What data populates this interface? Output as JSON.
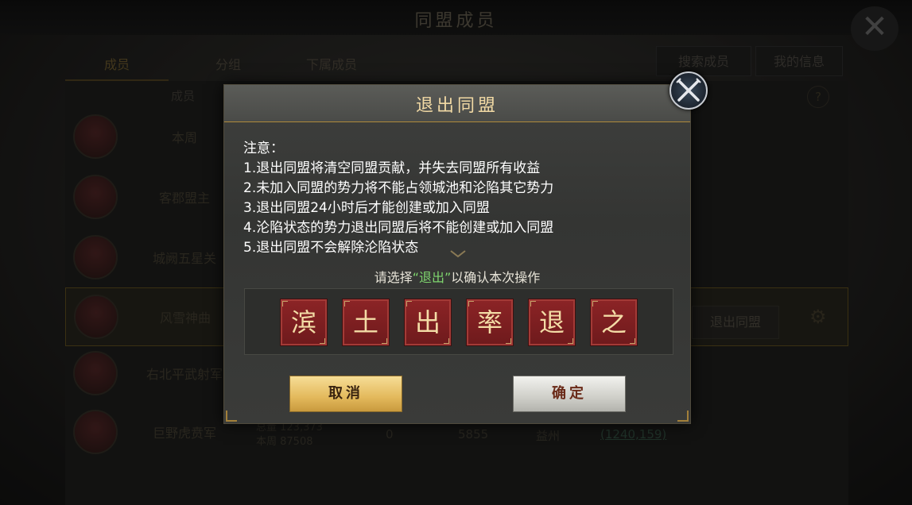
{
  "background": {
    "title": "同盟成员",
    "tabs": [
      "成员",
      "分组",
      "下属成员"
    ],
    "search_button": "搜索成员",
    "mine_button": "我的信息",
    "column_header": "成员",
    "help": "?",
    "rows": [
      {
        "name": "本周"
      },
      {
        "name": "客郡盟主"
      },
      {
        "name": "城阙五星关"
      },
      {
        "name": "风雪神曲"
      },
      {
        "name": "右北平武射军"
      },
      {
        "name": "巨野虎贲军"
      }
    ],
    "exit_button": "退出同盟",
    "stat_lines": [
      "总量 123,373",
      "本周 87508"
    ],
    "stat_b": "0",
    "stat_c": "5855",
    "stat_d": "益州",
    "stat_e": "(1240,159)"
  },
  "dialog": {
    "title": "退出同盟",
    "notes": [
      "注意：",
      "1.退出同盟将清空同盟贡献，并失去同盟所有收益",
      "2.未加入同盟的势力将不能占领城池和沦陷其它势力",
      "3.退出同盟24小时后才能创建或加入同盟",
      "4.沦陷状态的势力退出同盟后将不能创建或加入同盟",
      "5.退出同盟不会解除沦陷状态"
    ],
    "prompt_before": "请选择",
    "prompt_highlight": "“退出”",
    "prompt_after": "以确认本次操作",
    "characters": [
      "滨",
      "土",
      "出",
      "率",
      "退",
      "之"
    ],
    "cancel_label": "取消",
    "confirm_label": "确定"
  },
  "colors": {
    "title_gold": "#f1d9a4",
    "tile_red": "#8c2426",
    "highlight_green": "#7fd66e",
    "cancel_gold": "#e3b95c",
    "confirm_silver": "#cfcfc9"
  }
}
